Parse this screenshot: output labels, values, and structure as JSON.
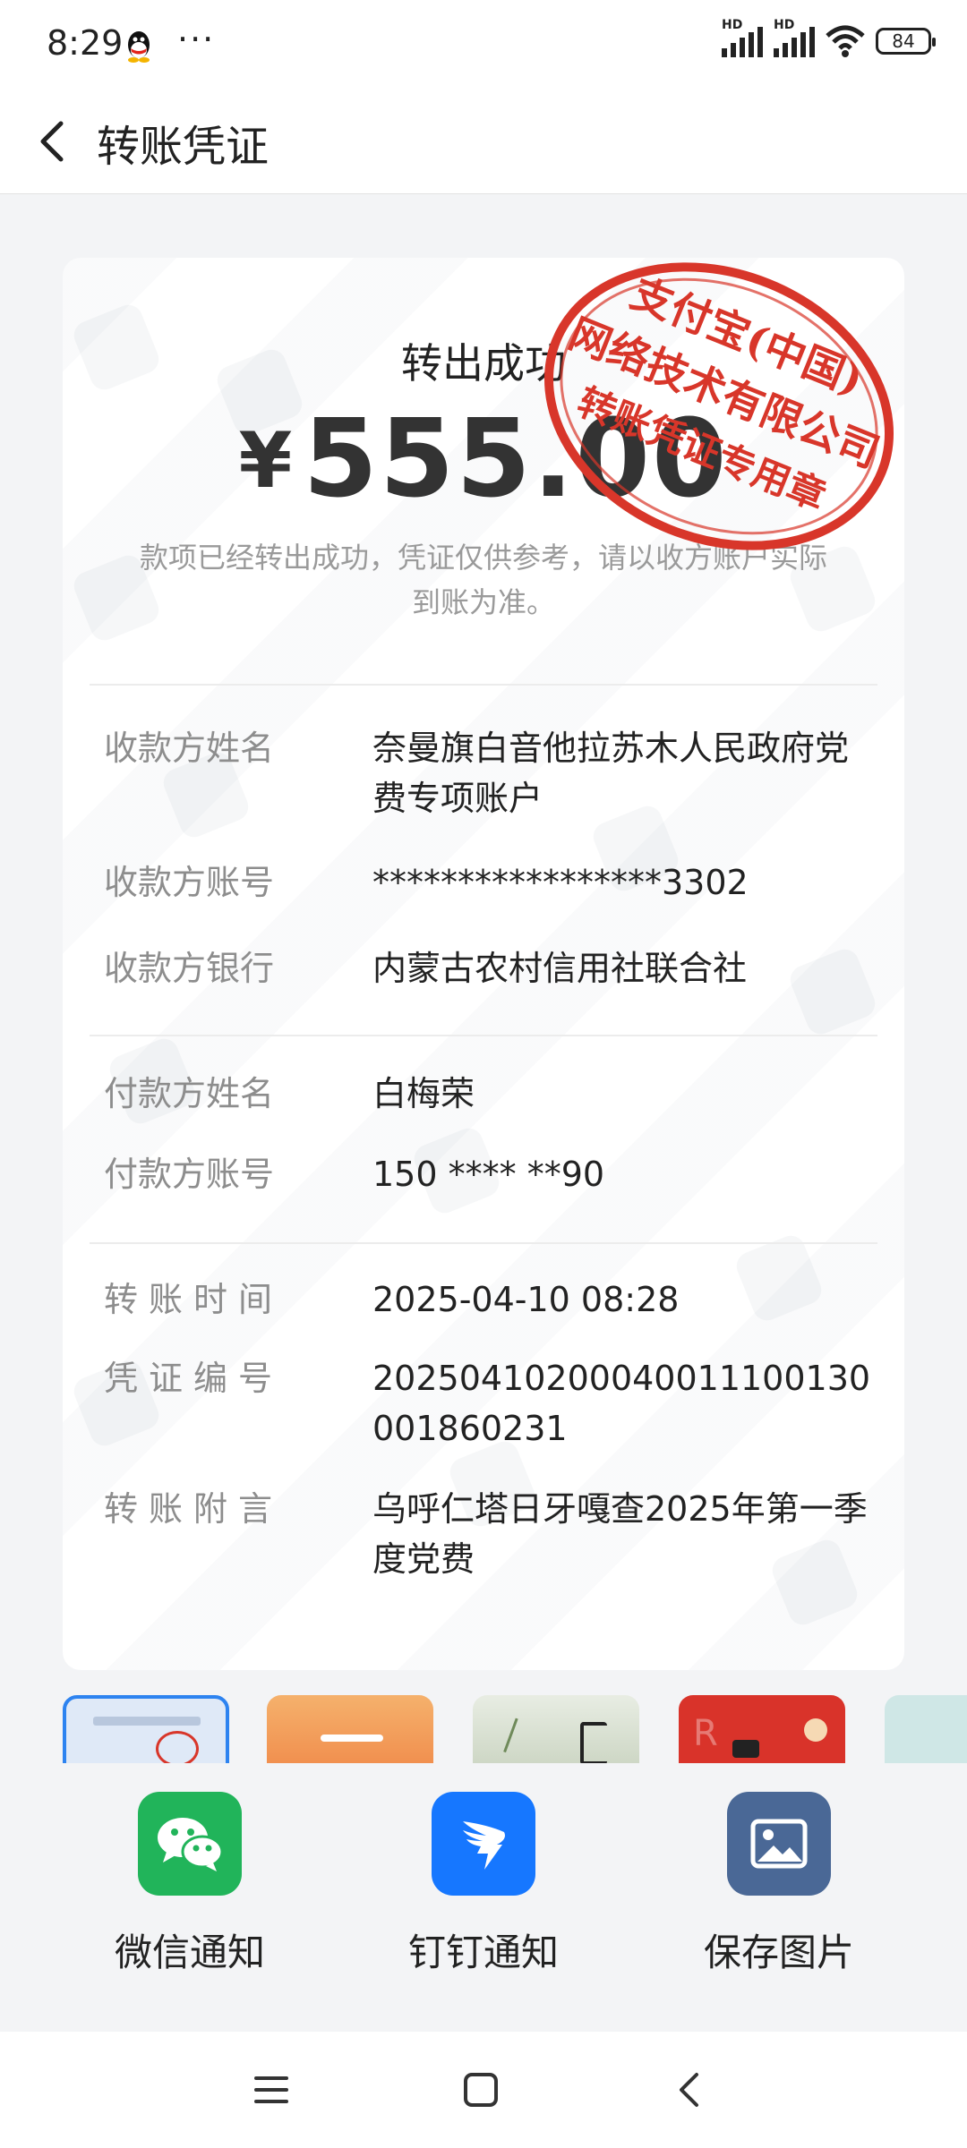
{
  "status_bar": {
    "time": "8:29",
    "more": "···",
    "signal_tag_1": "HD",
    "signal_tag_2": "HD",
    "battery": "84",
    "icons": [
      "qq-icon",
      "signal-icon",
      "wifi-icon",
      "battery-icon"
    ]
  },
  "header": {
    "title": "转账凭证",
    "back_icon": "chevron-left-icon"
  },
  "receipt": {
    "status": "转出成功",
    "currency": "¥",
    "amount": "555.00",
    "note": "款项已经转出成功，凭证仅供参考，请以收方账户实际到账为准。",
    "payee_section": [
      {
        "label": "收款方姓名",
        "value": "奈曼旗白音他拉苏木人民政府党费专项账户"
      },
      {
        "label": "收款方账号",
        "value": "*****************3302"
      },
      {
        "label": "收款方银行",
        "value": "内蒙古农村信用社联合社"
      }
    ],
    "payer_section": [
      {
        "label": "付款方姓名",
        "value": "白梅荣"
      },
      {
        "label": "付款方账号",
        "value": "150 **** **90"
      }
    ],
    "transfer_section": [
      {
        "label": "转账时间",
        "value": "2025-04-10 08:28"
      },
      {
        "label": "凭证编号",
        "value": "20250410200040011100130001860231"
      },
      {
        "label": "转账附言",
        "value": "乌呼仁塔日牙嘎查2025年第一季度党费"
      }
    ]
  },
  "stamp": {
    "line1": "支付宝(中国)",
    "line2": "网络技术有限公司",
    "line3": "转账凭证专用章",
    "color": "#d8362a"
  },
  "share": [
    {
      "label": "微信通知",
      "icon": "wechat-icon",
      "color": "#21b45a"
    },
    {
      "label": "钉钉通知",
      "icon": "dingtalk-icon",
      "color": "#1677ff"
    },
    {
      "label": "保存图片",
      "icon": "image-icon",
      "color": "#4a6896"
    }
  ],
  "nav_bar": {
    "icons": [
      "menu-icon",
      "home-icon",
      "back-icon"
    ]
  },
  "colors": {
    "background": "#f3f4f6",
    "card": "#ffffff",
    "label": "#8d8d8d",
    "accent": "#2d83f0"
  }
}
